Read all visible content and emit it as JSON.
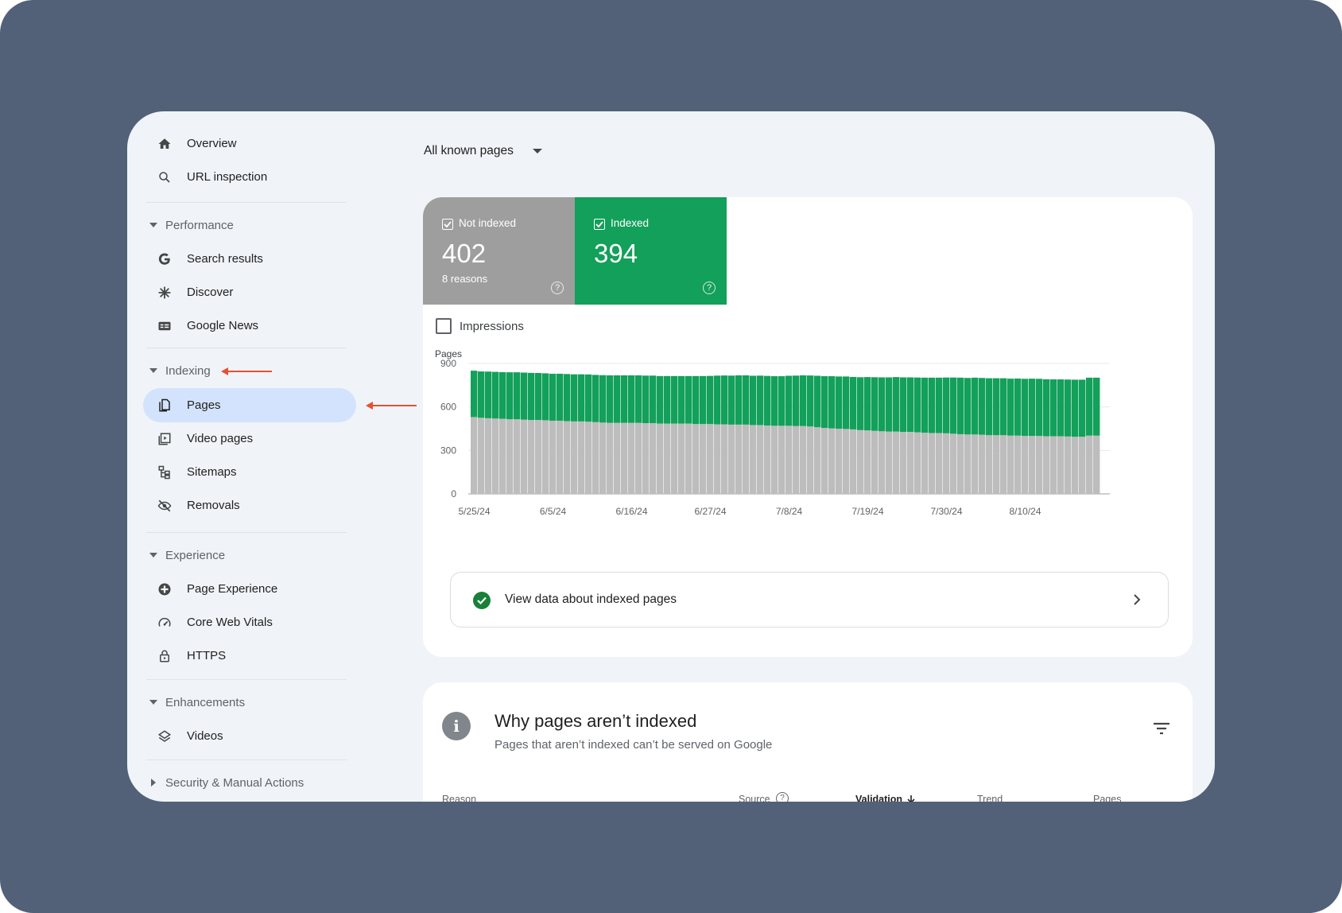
{
  "sidebar": {
    "top_items": [
      {
        "label": "Overview",
        "icon": "home-icon"
      },
      {
        "label": "URL inspection",
        "icon": "search-icon"
      }
    ],
    "sections": [
      {
        "label": "Performance",
        "items": [
          {
            "label": "Search results",
            "icon": "google-g-icon"
          },
          {
            "label": "Discover",
            "icon": "asterisk-icon"
          },
          {
            "label": "Google News",
            "icon": "news-icon"
          }
        ]
      },
      {
        "label": "Indexing",
        "items": [
          {
            "label": "Pages",
            "icon": "pages-icon",
            "active": true
          },
          {
            "label": "Video pages",
            "icon": "video-pages-icon"
          },
          {
            "label": "Sitemaps",
            "icon": "sitemap-icon"
          },
          {
            "label": "Removals",
            "icon": "eye-off-icon"
          }
        ]
      },
      {
        "label": "Experience",
        "items": [
          {
            "label": "Page Experience",
            "icon": "plus-circle-icon"
          },
          {
            "label": "Core Web Vitals",
            "icon": "gauge-icon"
          },
          {
            "label": "HTTPS",
            "icon": "lock-icon"
          }
        ]
      },
      {
        "label": "Enhancements",
        "items": [
          {
            "label": "Videos",
            "icon": "layers-icon"
          }
        ]
      },
      {
        "label": "Security & Manual Actions",
        "items": []
      }
    ]
  },
  "filter": {
    "label": "All known pages"
  },
  "tiles": {
    "not_indexed": {
      "label": "Not indexed",
      "value": "402",
      "sub": "8 reasons",
      "color": "#9e9e9e"
    },
    "indexed": {
      "label": "Indexed",
      "value": "394",
      "color": "#13a05a"
    }
  },
  "impressions_label": "Impressions",
  "view_data_label": "View data about indexed pages",
  "why": {
    "title": "Why pages aren’t indexed",
    "subtitle": "Pages that aren’t indexed can’t be served on Google",
    "columns": [
      "Reason",
      "Source",
      "Validation",
      "Trend",
      "Pages"
    ]
  },
  "colors": {
    "indexed": "#13a05a",
    "not_indexed": "#bdbdbd",
    "annotation_arrow": "#e8502f",
    "active_nav": "#d3e3fd"
  },
  "chart_data": {
    "type": "bar",
    "stacked": true,
    "ylabel": "Pages",
    "ylim": [
      0,
      900
    ],
    "yticks": [
      0,
      300,
      600,
      900
    ],
    "xtick_labels": [
      "5/25/24",
      "6/5/24",
      "6/16/24",
      "6/27/24",
      "7/8/24",
      "7/19/24",
      "7/30/24",
      "8/10/24"
    ],
    "xtick_index": [
      0,
      11,
      22,
      33,
      44,
      55,
      66,
      77
    ],
    "categories": [
      "5/25/24",
      "5/26/24",
      "5/27/24",
      "5/28/24",
      "5/29/24",
      "5/30/24",
      "5/31/24",
      "6/1/24",
      "6/2/24",
      "6/3/24",
      "6/4/24",
      "6/5/24",
      "6/6/24",
      "6/7/24",
      "6/8/24",
      "6/9/24",
      "6/10/24",
      "6/11/24",
      "6/12/24",
      "6/13/24",
      "6/14/24",
      "6/15/24",
      "6/16/24",
      "6/17/24",
      "6/18/24",
      "6/19/24",
      "6/20/24",
      "6/21/24",
      "6/22/24",
      "6/23/24",
      "6/24/24",
      "6/25/24",
      "6/26/24",
      "6/27/24",
      "6/28/24",
      "6/29/24",
      "6/30/24",
      "7/1/24",
      "7/2/24",
      "7/3/24",
      "7/4/24",
      "7/5/24",
      "7/6/24",
      "7/7/24",
      "7/8/24",
      "7/9/24",
      "7/10/24",
      "7/11/24",
      "7/12/24",
      "7/13/24",
      "7/14/24",
      "7/15/24",
      "7/16/24",
      "7/17/24",
      "7/18/24",
      "7/19/24",
      "7/20/24",
      "7/21/24",
      "7/22/24",
      "7/23/24",
      "7/24/24",
      "7/25/24",
      "7/26/24",
      "7/27/24",
      "7/28/24",
      "7/29/24",
      "7/30/24",
      "7/31/24",
      "8/1/24",
      "8/2/24",
      "8/3/24",
      "8/4/24",
      "8/5/24",
      "8/6/24",
      "8/7/24",
      "8/8/24",
      "8/9/24",
      "8/10/24",
      "8/11/24",
      "8/12/24",
      "8/13/24",
      "8/14/24",
      "8/15/24",
      "8/16/24",
      "8/17/24",
      "8/18/24",
      "8/19/24",
      "8/20/24"
    ],
    "series": [
      {
        "name": "Not indexed",
        "color": "#bdbdbd",
        "values": [
          530,
          525,
          522,
          520,
          518,
          515,
          515,
          512,
          510,
          510,
          508,
          505,
          505,
          502,
          500,
          500,
          498,
          495,
          492,
          490,
          490,
          490,
          490,
          490,
          488,
          488,
          485,
          485,
          485,
          485,
          485,
          482,
          482,
          482,
          480,
          480,
          478,
          478,
          478,
          475,
          475,
          472,
          470,
          470,
          470,
          468,
          468,
          465,
          460,
          455,
          452,
          450,
          448,
          445,
          440,
          438,
          435,
          432,
          430,
          430,
          428,
          428,
          425,
          422,
          420,
          420,
          418,
          415,
          412,
          410,
          410,
          408,
          405,
          405,
          405,
          402,
          402,
          400,
          400,
          400,
          398,
          398,
          398,
          396,
          394,
          394,
          402,
          402
        ]
      },
      {
        "name": "Indexed",
        "color": "#13a05a",
        "values": [
          320,
          320,
          322,
          322,
          322,
          324,
          324,
          325,
          325,
          324,
          324,
          324,
          324,
          325,
          325,
          325,
          326,
          326,
          327,
          328,
          328,
          328,
          328,
          328,
          328,
          328,
          328,
          328,
          328,
          328,
          328,
          331,
          331,
          332,
          336,
          337,
          338,
          340,
          340,
          340,
          341,
          342,
          342,
          342,
          345,
          348,
          350,
          352,
          355,
          357,
          360,
          360,
          362,
          362,
          365,
          368,
          370,
          372,
          374,
          376,
          376,
          376,
          378,
          380,
          382,
          382,
          385,
          388,
          390,
          390,
          392,
          392,
          393,
          393,
          393,
          393,
          394,
          394,
          395,
          394,
          393,
          392,
          392,
          393,
          394,
          394,
          400,
          400
        ]
      }
    ]
  }
}
